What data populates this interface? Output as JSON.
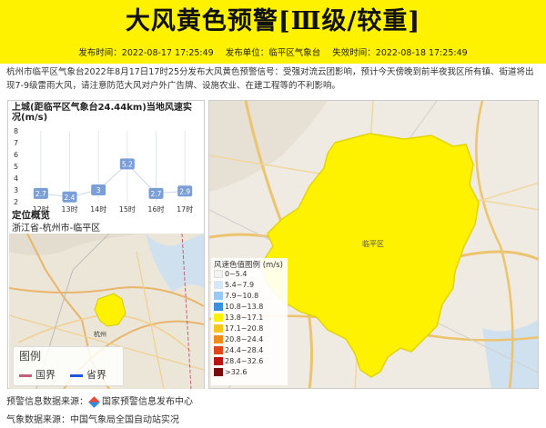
{
  "header": {
    "title": "大风黄色预警[Ⅲ级/较重]",
    "issue_time": "发布时间：2022-08-17 17:25:49",
    "issuer": "发布单位：临平区气象台",
    "expire_time": "失效时间：2022-08-18 17:25:49"
  },
  "description": "杭州市临平区气象台2022年8月17日17时25分发布大风黄色预警信号：受强对流云团影响，预计今天傍晚到前半夜我区所有镇、街道将出现7-9级雷雨大风，请注意防范大风对户外广告牌、设施农业、在建工程等的不利影响。",
  "wind_chart": {
    "title": "上城(距临平区气象台24.44km)当地风速实况(m/s)"
  },
  "chart_data": {
    "type": "line",
    "categories": [
      "12时",
      "13时",
      "14时",
      "15时",
      "16时",
      "17时"
    ],
    "values": [
      2.7,
      2.4,
      3,
      5.2,
      2.7,
      2.9
    ],
    "value_labels": [
      "2.7",
      "2.4",
      "3",
      "5.2",
      "2.7",
      "2.9"
    ],
    "ylim": [
      2,
      8
    ],
    "yticks": [
      "2",
      "3",
      "4",
      "5",
      "6",
      "7",
      "8"
    ],
    "color": "#7a9fd6"
  },
  "location": {
    "title": "定位概览",
    "region": "浙江省-杭州市-临平区"
  },
  "mini_map_legend": {
    "title": "图例",
    "items": [
      {
        "label": "国界",
        "color": "#c0607a"
      },
      {
        "label": "省界",
        "color": "#2057d6"
      }
    ]
  },
  "speed_legend": {
    "title": "风速色值图例 (m/s)",
    "items": [
      {
        "label": "0~5.4",
        "color": "#f2f2f2"
      },
      {
        "label": "5.4~7.9",
        "color": "#d7e7f7"
      },
      {
        "label": "7.9~10.8",
        "color": "#9cc7ee"
      },
      {
        "label": "10.8~13.8",
        "color": "#3c8fdd"
      },
      {
        "label": "13.8~17.1",
        "color": "#fff200"
      },
      {
        "label": "17.1~20.8",
        "color": "#f7c61f"
      },
      {
        "label": "20.8~24.4",
        "color": "#f08c1a"
      },
      {
        "label": "24.4~28.4",
        "color": "#e4461c"
      },
      {
        "label": "28.4~32.6",
        "color": "#b81616"
      },
      {
        "label": ">32.6",
        "color": "#7a0b0b"
      }
    ]
  },
  "map_labels": {
    "big_map_place": "临平区",
    "mini_map_place": "杭州"
  },
  "footer": {
    "warning_source": "预警信息数据来源：",
    "warning_source_name": "国家预警信息发布中心",
    "weather_source": "气象数据来源：中国气象局全国自动站实况"
  }
}
